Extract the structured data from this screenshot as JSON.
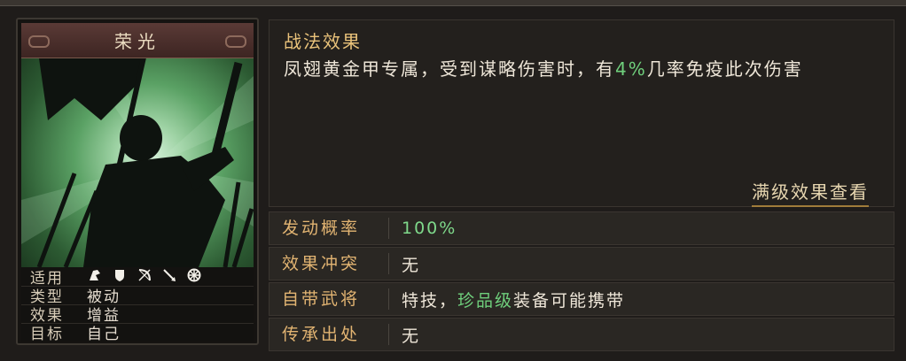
{
  "card": {
    "title": "荣光",
    "info": [
      {
        "key": "适用",
        "icons": [
          "cavalry-icon",
          "shield-icon",
          "bow-icon",
          "spear-icon",
          "wheel-icon"
        ]
      },
      {
        "key": "类型",
        "value": "被动"
      },
      {
        "key": "效果",
        "value": "增益"
      },
      {
        "key": "目标",
        "value": "自己"
      }
    ]
  },
  "effect": {
    "heading": "战法效果",
    "text_before": "凤翅黄金甲专属，受到谋略伤害时，有",
    "text_highlight": "4%",
    "text_after": "几率免疫此次伤害",
    "full_level_link": "满级效果查看"
  },
  "props": {
    "trigger_rate": {
      "label": "发动概率",
      "value": "100%"
    },
    "effect_conflict": {
      "label": "效果冲突",
      "value": "无"
    },
    "own_general": {
      "label": "自带武将",
      "value_before": "特技，",
      "value_highlight": "珍品级",
      "value_after": "装备可能携带"
    },
    "inherit_source": {
      "label": "传承出处",
      "value": "无"
    }
  },
  "colors": {
    "accent_gold": "#e2b472",
    "highlight_green": "#6fcf7c"
  }
}
